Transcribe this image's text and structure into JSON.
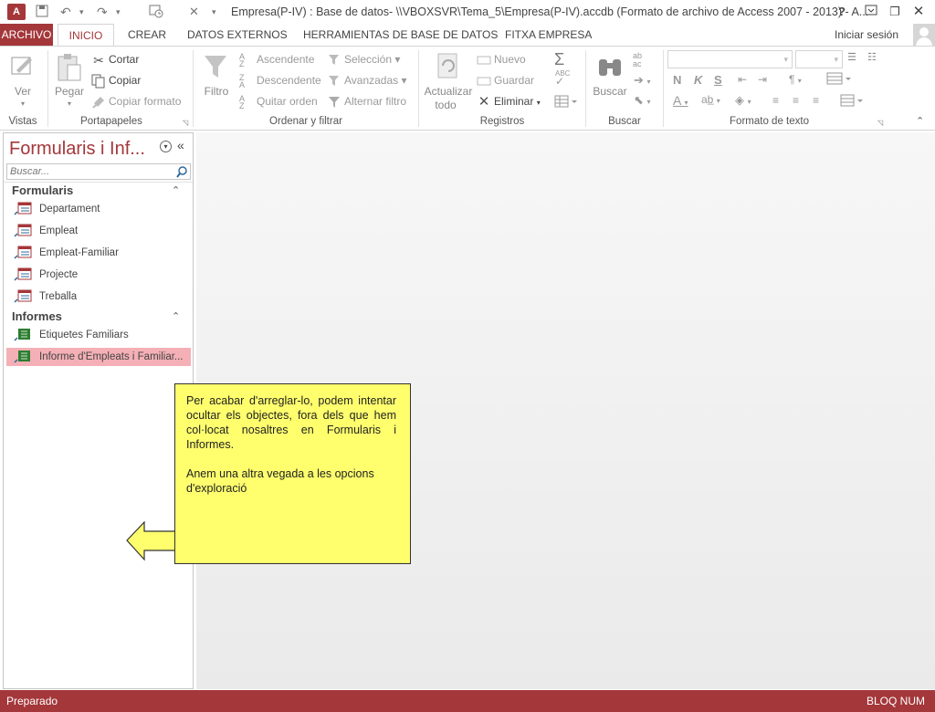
{
  "window": {
    "title": "Empresa(P-IV) : Base de datos- \\\\VBOXSVR\\Tema_5\\Empresa(P-IV).accdb (Formato de archivo de Access 2007 - 2013) - A...",
    "help": "?",
    "sign_in": "Iniciar sesión"
  },
  "tabs": [
    "ARCHIVO",
    "INICIO",
    "CREAR",
    "DATOS EXTERNOS",
    "HERRAMIENTAS DE BASE DE DATOS",
    "FITXA EMPRESA"
  ],
  "ribbon": {
    "vistas": {
      "ver": "Ver",
      "group": "Vistas"
    },
    "portapapeles": {
      "pegar": "Pegar",
      "cortar": "Cortar",
      "copiar": "Copiar",
      "copiar_formato": "Copiar formato",
      "group": "Portapapeles"
    },
    "ordenar": {
      "filtro": "Filtro",
      "ascendente": "Ascendente",
      "descendente": "Descendente",
      "quitar_orden": "Quitar orden",
      "seleccion": "Selección",
      "avanzadas": "Avanzadas",
      "alternar": "Alternar filtro",
      "group": "Ordenar y filtrar"
    },
    "registros": {
      "actualizar_1": "Actualizar",
      "actualizar_2": "todo",
      "nuevo": "Nuevo",
      "guardar": "Guardar",
      "eliminar": "Eliminar",
      "group": "Registros"
    },
    "buscar": {
      "buscar": "Buscar",
      "group": "Buscar"
    },
    "formato": {
      "n": "N",
      "k": "K",
      "s": "S",
      "group": "Formato de texto"
    }
  },
  "nav": {
    "title": "Formularis i Inf...",
    "search_placeholder": "Buscar...",
    "sections": [
      {
        "name": "Formularis",
        "items": [
          "Departament",
          "Empleat",
          "Empleat-Familiar",
          "Projecte",
          "Treballa"
        ]
      },
      {
        "name": "Informes",
        "items": [
          "Etiquetes Familiars",
          "Informe d'Empleats i Familiar..."
        ]
      }
    ]
  },
  "callout": {
    "p1": "Per acabar d'arreglar-lo, podem intentar ocultar els objectes, fora dels que hem col·locat nosaltres en Formularis i Informes.",
    "p2": "Anem una altra vegada a les opcions d'exploració"
  },
  "status": {
    "left": "Preparado",
    "right": "BLOQ NUM"
  },
  "colors": {
    "accent": "#a4373a",
    "selected_item": "#f4b0b6",
    "callout": "#ffff6e"
  }
}
